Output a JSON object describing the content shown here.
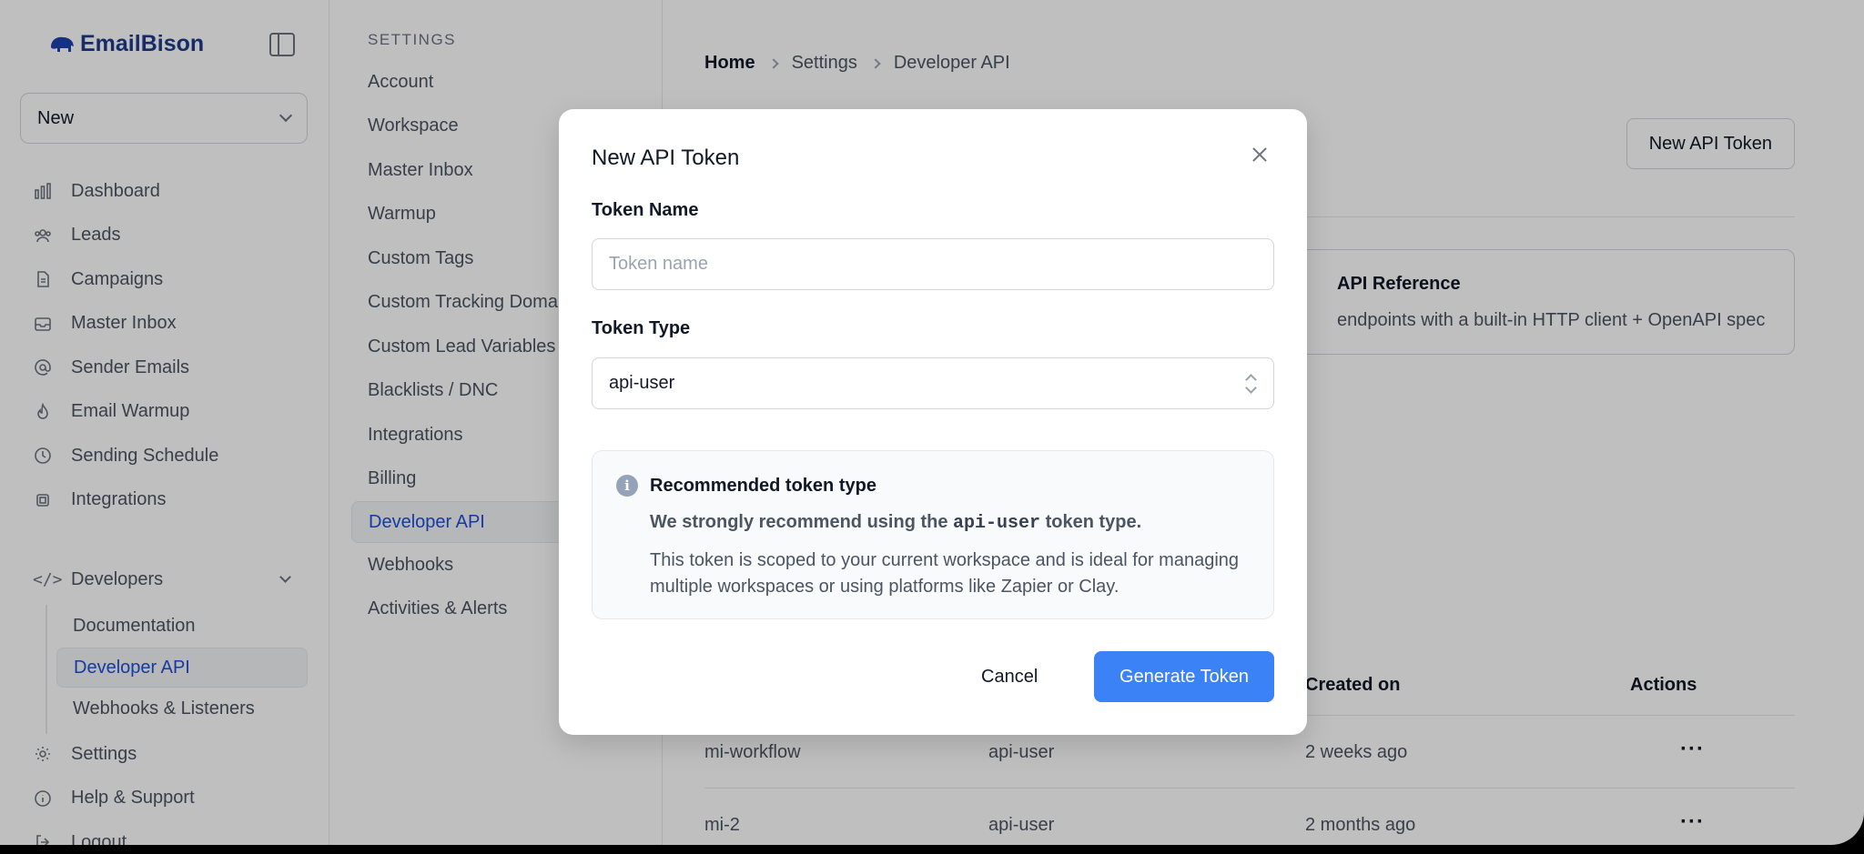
{
  "app": {
    "name": "EmailBison"
  },
  "workspace": {
    "selected": "New"
  },
  "sidebar": {
    "items": [
      {
        "label": "Dashboard",
        "icon": "chart-bars-icon"
      },
      {
        "label": "Leads",
        "icon": "users-icon"
      },
      {
        "label": "Campaigns",
        "icon": "document-icon"
      },
      {
        "label": "Master Inbox",
        "icon": "inbox-icon"
      },
      {
        "label": "Sender Emails",
        "icon": "at-sign-icon"
      },
      {
        "label": "Email Warmup",
        "icon": "flame-icon"
      },
      {
        "label": "Sending Schedule",
        "icon": "clock-icon"
      },
      {
        "label": "Integrations",
        "icon": "chip-icon"
      }
    ],
    "developers": {
      "label": "Developers",
      "icon": "code-icon",
      "children": [
        "Documentation",
        "Developer API",
        "Webhooks & Listeners"
      ]
    },
    "bottom": [
      {
        "label": "Settings",
        "icon": "gear-icon"
      },
      {
        "label": "Help & Support",
        "icon": "info-circle-icon"
      },
      {
        "label": "Logout",
        "icon": "logout-icon"
      }
    ]
  },
  "settings": {
    "title": "SETTINGS",
    "items": [
      "Account",
      "Workspace",
      "Master Inbox",
      "Warmup",
      "Custom Tags",
      "Custom Tracking Domains",
      "Custom Lead Variables",
      "Blacklists / DNC",
      "Integrations",
      "Billing",
      "Developer API",
      "Webhooks",
      "Activities & Alerts"
    ]
  },
  "breadcrumb": [
    "Home",
    "Settings",
    "Developer API"
  ],
  "main": {
    "new_token_button": "New API Token",
    "reference_card": {
      "title": "API Reference",
      "description": "endpoints with a built-in HTTP client + OpenAPI spec"
    },
    "table": {
      "headers": [
        "Created on",
        "Actions"
      ],
      "rows": [
        {
          "name": "mi-workflow",
          "type": "api-user",
          "created": "2 weeks ago"
        },
        {
          "name": "mi-2",
          "type": "api-user",
          "created": "2 months ago"
        }
      ]
    }
  },
  "modal": {
    "title": "New API Token",
    "token_name_label": "Token Name",
    "token_name_placeholder": "Token name",
    "token_type_label": "Token Type",
    "token_type_value": "api-user",
    "info": {
      "title": "Recommended token type",
      "strong_prefix": "We strongly recommend using the",
      "strong_code": "api-user",
      "strong_suffix": "token type.",
      "body": "This token is scoped to your current workspace and is ideal for managing multiple workspaces or using platforms like Zapier or Clay."
    },
    "cancel_label": "Cancel",
    "generate_label": "Generate Token"
  },
  "colors": {
    "primary": "#3b82f6",
    "active_link": "#1d4ed8",
    "brand": "#1e3a8a"
  }
}
